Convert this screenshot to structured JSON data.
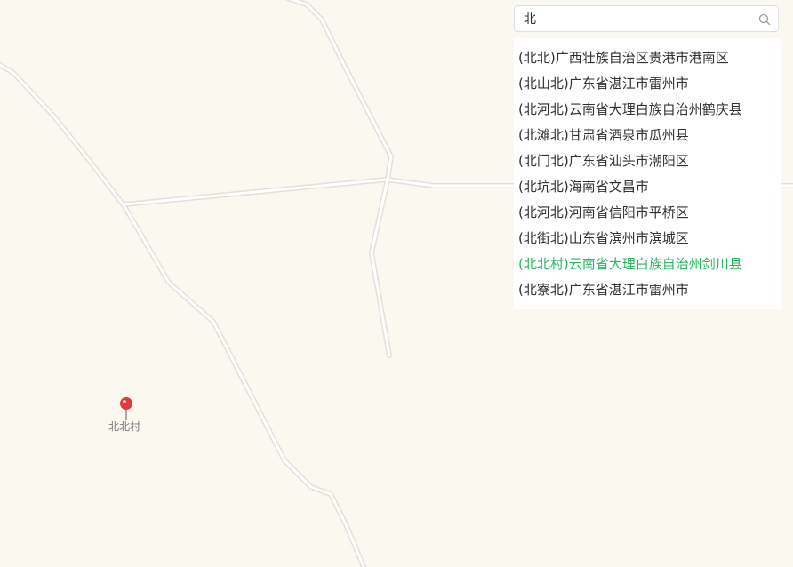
{
  "map": {
    "background_color": "#fbf8f0",
    "road_color": "#ffffff",
    "road_casing_color": "#e3e0da",
    "marker": {
      "label": "北北村",
      "icon": "map-pin-icon",
      "color": "#e03a3a"
    }
  },
  "search": {
    "value": "北",
    "placeholder": "",
    "icon": "search-icon"
  },
  "results": {
    "highlight_color": "#2ab65e",
    "selected_index": 8,
    "items": [
      "(北北)广西壮族自治区贵港市港南区",
      "(北山北)广东省湛江市雷州市",
      "(北河北)云南省大理白族自治州鹤庆县",
      "(北滩北)甘肃省酒泉市瓜州县",
      "(北门北)广东省汕头市潮阳区",
      "(北坑北)海南省文昌市",
      "(北河北)河南省信阳市平桥区",
      "(北街北)山东省滨州市滨城区",
      "(北北村)云南省大理白族自治州剑川县",
      "(北寮北)广东省湛江市雷州市"
    ]
  }
}
